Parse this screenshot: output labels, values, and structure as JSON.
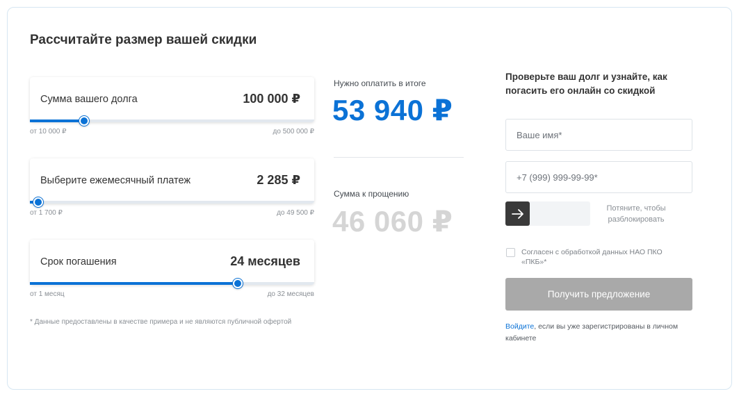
{
  "calculator": {
    "title": "Рассчитайте размер вашей скидки",
    "sliders": [
      {
        "label": "Сумма вашего долга",
        "value": "100 000 ₽",
        "min": "от 10 000 ₽",
        "max": "до 500 000 ₽",
        "fraction": 0.19
      },
      {
        "label": "Выберите ежемесячный платеж",
        "value": "2 285 ₽",
        "min": "от 1 700 ₽",
        "max": "до 49 500 ₽",
        "fraction": 0.03
      },
      {
        "label": "Срок погашения",
        "value": "24 месяцев",
        "min": "от 1 месяц",
        "max": "до 32 месяцев",
        "fraction": 0.73
      }
    ],
    "footnote": "* Данные предоставлены в качестве примера и не являются публичной офертой"
  },
  "summary": {
    "to_pay_label": "Нужно оплатить в итоге",
    "to_pay_value": "53 940 ₽",
    "forgiven_label": "Сумма к прощению",
    "forgiven_value": "46 060 ₽"
  },
  "form": {
    "heading": "Проверьте ваш долг и узнайте, как погасить его онлайн со скидкой",
    "name_placeholder": "Ваше имя*",
    "phone_placeholder": "+7 (999) 999-99-99*",
    "unlock_hint": "Потяните, чтобы разблокировать",
    "consent": "Согласен с обработкой данных НАО ПКО «ПКБ»*",
    "submit_label": "Получить предложение",
    "login_link": "Войдите",
    "login_rest": ", если вы уже зарегистрированы в личном кабинете"
  },
  "colors": {
    "accent": "#0b72d6",
    "muted_value": "#d5d5d5",
    "button_disabled": "#a9a9a9"
  },
  "icons": {
    "unlock_handle": "arrow-right-icon"
  }
}
